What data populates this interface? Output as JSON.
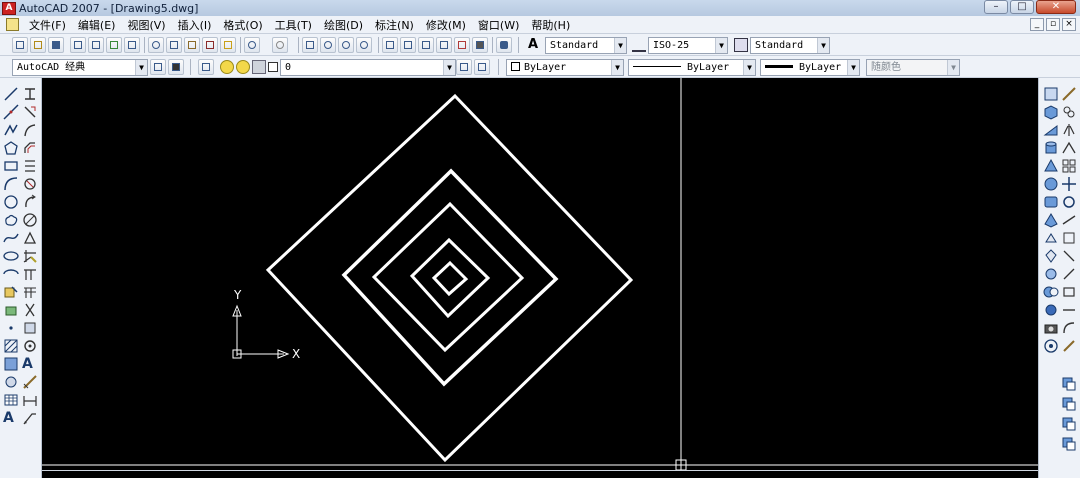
{
  "window": {
    "title": "AutoCAD 2007 - [Drawing5.dwg]",
    "app_icon_label": "A",
    "buttons": {
      "minimize": "–",
      "maximize": "□",
      "close": "✕"
    }
  },
  "menubar": {
    "items": [
      "文件(F)",
      "编辑(E)",
      "视图(V)",
      "插入(I)",
      "格式(O)",
      "工具(T)",
      "绘图(D)",
      "标注(N)",
      "修改(M)",
      "窗口(W)",
      "帮助(H)"
    ],
    "doc_buttons": {
      "minimize": "_",
      "restore": "▫",
      "close": "×"
    }
  },
  "toolbar_styles": {
    "text_style": "Standard",
    "dim_style": "ISO-25",
    "table_style": "Standard"
  },
  "toolbar_layers": {
    "workspace": "AutoCAD 经典",
    "layer": "0",
    "color": "ByLayer",
    "linetype": "ByLayer",
    "lineweight": "ByLayer",
    "plot_style": "随颜色"
  },
  "drawing": {
    "ucs_x_label": "X",
    "ucs_y_label": "Y",
    "shape": "nested squares rotated 45°",
    "line_color": "#ffffff",
    "background": "#000000"
  },
  "colors": {
    "canvas": "#000000",
    "chrome": "#eef2f8",
    "title_gradient": "#c9d9ec"
  }
}
